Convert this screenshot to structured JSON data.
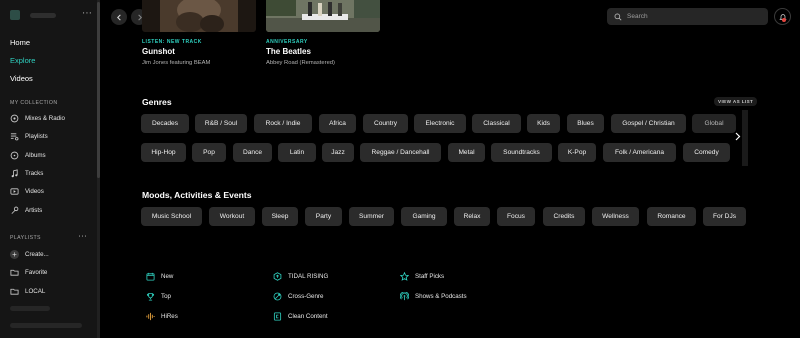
{
  "sidebar": {
    "nav": [
      "Home",
      "Explore",
      "Videos"
    ],
    "my_collection_label": "MY COLLECTION",
    "collection": [
      {
        "label": "Mixes & Radio",
        "icon": "mixes-radio-icon"
      },
      {
        "label": "Playlists",
        "icon": "playlists-icon"
      },
      {
        "label": "Albums",
        "icon": "albums-icon"
      },
      {
        "label": "Tracks",
        "icon": "tracks-icon"
      },
      {
        "label": "Videos",
        "icon": "videos-icon"
      },
      {
        "label": "Artists",
        "icon": "artists-icon"
      }
    ],
    "playlists_label": "PLAYLISTS",
    "playlist_menu": "⋯",
    "playlists": [
      {
        "label": "Create...",
        "icon": "plus-icon"
      },
      {
        "label": "Favorite",
        "icon": "folder-icon"
      },
      {
        "label": "LOCAL",
        "icon": "folder-icon"
      }
    ],
    "user_menu": "⋯"
  },
  "topbar": {
    "search_placeholder": "Search"
  },
  "featured": [
    {
      "tag": "LISTEN: NEW TRACK",
      "title": "Gunshot",
      "subtitle": "Jim Jones featuring BEAM"
    },
    {
      "tag": "ANNIVERSARY",
      "title": "The Beatles",
      "subtitle": "Abbey Road (Remastered)"
    }
  ],
  "genres": {
    "title": "Genres",
    "view_as_list": "VIEW AS LIST",
    "row1": [
      "Decades",
      "R&B / Soul",
      "Rock / Indie",
      "Africa",
      "Country",
      "Electronic",
      "Classical",
      "Kids",
      "Blues",
      "Gospel / Christian",
      "Global"
    ],
    "row2": [
      "Hip-Hop",
      "Pop",
      "Dance",
      "Latin",
      "Jazz",
      "Reggae / Dancehall",
      "Metal",
      "Soundtracks",
      "K-Pop",
      "Folk / Americana",
      "Comedy"
    ]
  },
  "moods": {
    "title": "Moods, Activities & Events",
    "items": [
      "Music School",
      "Workout",
      "Sleep",
      "Party",
      "Summer",
      "Gaming",
      "Relax",
      "Focus",
      "Credits",
      "Wellness",
      "Romance",
      "For DJs"
    ]
  },
  "links": [
    {
      "label": "New",
      "icon": "calendar-icon"
    },
    {
      "label": "Top",
      "icon": "trophy-icon"
    },
    {
      "label": "HiRes",
      "icon": "hires-icon"
    },
    {
      "label": "TIDAL RISING",
      "icon": "rising-icon"
    },
    {
      "label": "Cross-Genre",
      "icon": "cross-genre-icon"
    },
    {
      "label": "Clean Content",
      "icon": "clean-content-icon"
    },
    {
      "label": "Staff Picks",
      "icon": "star-icon"
    },
    {
      "label": "Shows & Podcasts",
      "icon": "podcast-icon"
    }
  ],
  "colors": {
    "accent": "#2fd1c0",
    "background": "#000000",
    "sidebar": "#151515",
    "pill": "#2b2b2b"
  }
}
